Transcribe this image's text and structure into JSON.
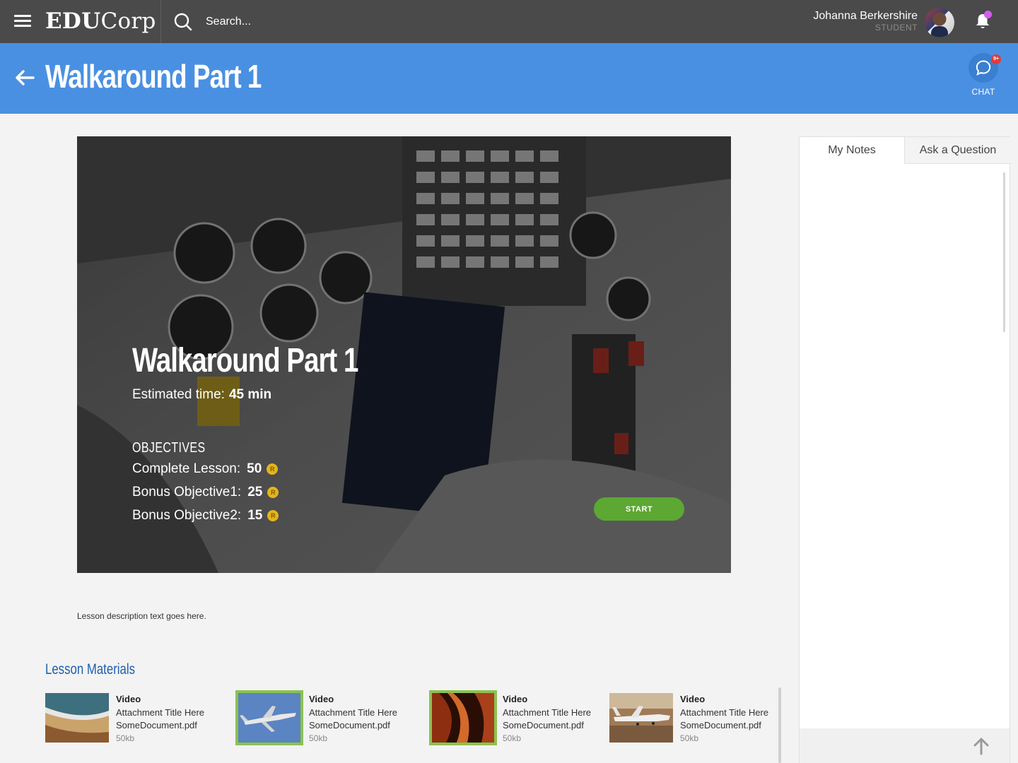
{
  "header": {
    "logo_bold": "EDU",
    "logo_light": "Corp",
    "search_placeholder": "Search...",
    "user_name": "Johanna Berkershire",
    "user_role": "STUDENT"
  },
  "titlebar": {
    "title": "Walkaround Part 1",
    "chat_label": "CHAT",
    "chat_badge": "9+"
  },
  "hero": {
    "title": "Walkaround Part 1",
    "time_label": "Estimated time:",
    "time_value": "45 min",
    "objectives_heading": "OBJECTIVES",
    "objectives": [
      {
        "label": "Complete Lesson:",
        "points": "50"
      },
      {
        "label": "Bonus Objective1:",
        "points": "25"
      },
      {
        "label": "Bonus Objective2:",
        "points": "15"
      }
    ],
    "start_label": "START"
  },
  "lesson": {
    "description": "Lesson description text goes here.",
    "materials_heading": "Lesson Materials",
    "materials": [
      {
        "type": "Video",
        "title": "Attachment Title Here",
        "file": "SomeDocument.pdf",
        "size": "50kb",
        "thumb": "beach",
        "selected": false
      },
      {
        "type": "Video",
        "title": "Attachment Title Here",
        "file": "SomeDocument.pdf",
        "size": "50kb",
        "thumb": "jet-sky",
        "selected": true
      },
      {
        "type": "Video",
        "title": "Attachment Title Here",
        "file": "SomeDocument.pdf",
        "size": "50kb",
        "thumb": "canyon",
        "selected": true
      },
      {
        "type": "Video",
        "title": "Attachment Title Here",
        "file": "SomeDocument.pdf",
        "size": "50kb",
        "thumb": "jet-tarmac",
        "selected": false
      }
    ]
  },
  "panel": {
    "tabs": [
      {
        "label": "My Notes",
        "active": true
      },
      {
        "label": "Ask a Question",
        "active": false
      }
    ]
  },
  "colors": {
    "topbar": "#4a4a4a",
    "accent_blue": "#4a90e2",
    "start_green": "#5ca832",
    "selected_frame": "#8cc152",
    "heading_blue": "#1f5fae",
    "coin_gold": "#e4b41c"
  }
}
